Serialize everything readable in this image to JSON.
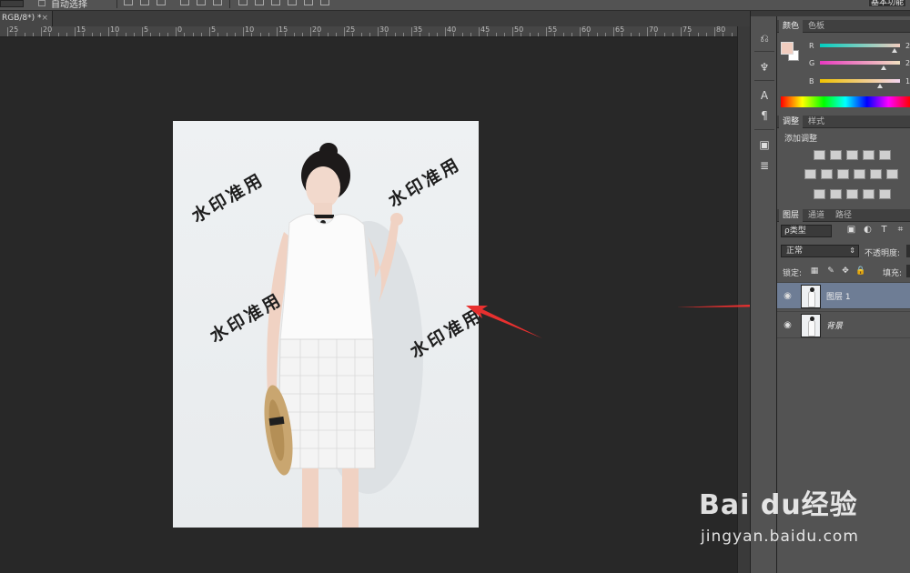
{
  "options_bar": {
    "auto_select_label": "自动选择",
    "workspace_label": "基本功能"
  },
  "document_tab": {
    "title": "RGB/8*) *",
    "close_glyph": "×"
  },
  "ruler": {
    "labels": [
      "25",
      "20",
      "15",
      "10",
      "5",
      "0",
      "5",
      "10",
      "15",
      "20",
      "25",
      "30",
      "35",
      "40",
      "45",
      "50",
      "55",
      "60",
      "65",
      "70",
      "75",
      "80"
    ]
  },
  "canvas": {
    "watermark_text": "水印准用"
  },
  "tool_strip": {
    "icons": [
      "history-icon",
      "brush-presets-icon",
      "character-icon",
      "paragraph-icon",
      "info-icon",
      "notes-icon"
    ]
  },
  "color_panel": {
    "tabs": [
      "颜色",
      "色板"
    ],
    "channels": [
      {
        "label": "R",
        "value": "2"
      },
      {
        "label": "G",
        "value": "2"
      },
      {
        "label": "B",
        "value": "1"
      }
    ],
    "foreground_color": "#f1cdbf",
    "background_color": "#ffffff"
  },
  "adjustments_panel": {
    "tabs": [
      "调整",
      "样式"
    ],
    "title": "添加调整"
  },
  "layers_panel": {
    "tabs": [
      "图层",
      "通道",
      "路径"
    ],
    "filter_label": "ρ类型",
    "blend_mode": "正常",
    "opacity_label": "不透明度:",
    "lock_label": "锁定:",
    "fill_label": "填充:",
    "layers": [
      {
        "name": "图层 1",
        "selected": true
      },
      {
        "name": "背景",
        "selected": false
      }
    ]
  },
  "site_watermark": {
    "brand": "Bai  du经验",
    "url": "jingyan.baidu.com"
  },
  "colors": {
    "selection_blue": "#6e7d95",
    "arrow_red": "#e8302f"
  }
}
